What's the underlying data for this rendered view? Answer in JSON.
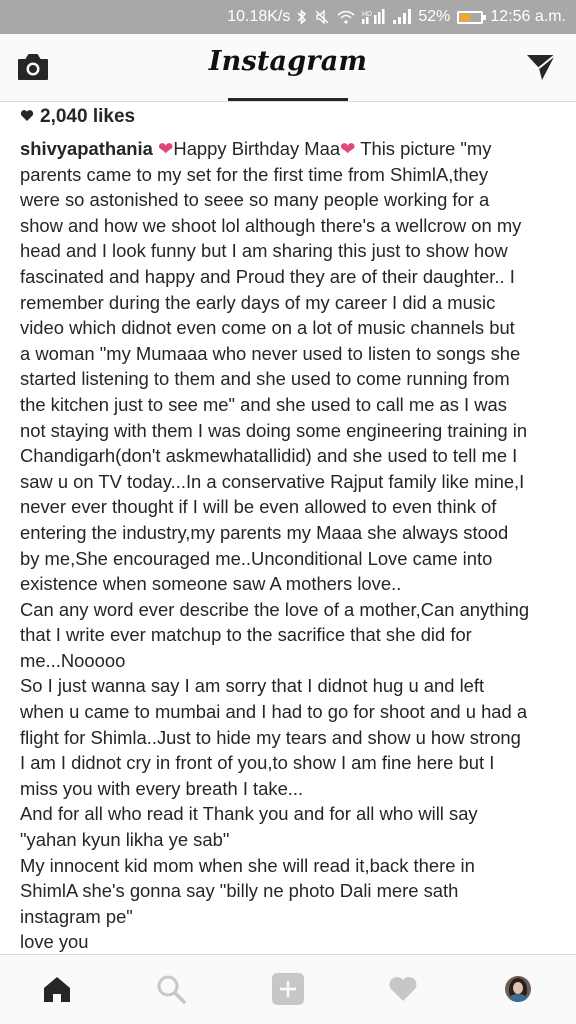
{
  "status_bar": {
    "speed": "10.18K/s",
    "battery_percent": "52%",
    "battery_level": 0.52,
    "time": "12:56 a.m.",
    "icons": [
      "bluetooth-icon",
      "mute-icon",
      "wifi-icon",
      "hd-signal-icon",
      "signal-icon",
      "signal-icon",
      "battery-icon"
    ]
  },
  "header": {
    "logo": "Instagram",
    "left_icon": "camera-icon",
    "right_icon": "direct-send-icon"
  },
  "post": {
    "likes": "2,040 likes",
    "username": "shivyapathania",
    "caption_lines": [
      "Happy Birthday Maa",
      " This picture \"my",
      "parents came to my set for the first time from ShimlA,they",
      "were so astonished to seee so many people working for a",
      "show and how we shoot lol although there's a wellcrow on my",
      "head and I look funny but I am sharing this just to show how",
      "fascinated and happy and Proud they are of their daughter.. I",
      "remember during the early days of my career I did a music",
      "video which didnot even come on a lot of music channels but",
      "a woman \"my Mumaaa who never used to listen to songs she",
      "started listening to them and  she used to come running from",
      "the kitchen just to see me\" and she used to call me as I was",
      "not staying with them I was doing some engineering training in",
      "Chandigarh(don't askmewhatallidid) and she used to tell me I",
      "saw u on TV today...In a conservative Rajput family like mine,I",
      "never ever thought if I will be even allowed to even think of",
      "entering the industry,my parents my Maaa she always stood",
      "by me,She encouraged me..Unconditional Love came into",
      "existence when someone saw A mothers love..",
      "Can any word ever describe the love of a mother,Can anything",
      "that I write ever matchup to the sacrifice that she did for",
      "me...Nooooo",
      "So I just wanna say I am sorry that I didnot hug u and left",
      "when u came to mumbai and I had to go for shoot and u had a",
      "flight for Shimla..Just to hide my tears and show u how strong",
      "I am I didnot cry in front of you,to show I am fine here but I",
      "miss you with every breath I take...",
      "And for all who read it Thank you and for all who will say",
      "\"yahan kyun likha ye sab\"",
      "My innocent kid mom when she will read it,back there in",
      "ShimlA she's gonna say \"billy ne photo Dali mere sath",
      "instagram pe\"",
      "love you"
    ]
  },
  "bottom_nav": {
    "items": [
      "home-icon",
      "search-icon",
      "add-post-icon",
      "activity-heart-icon",
      "profile-avatar"
    ],
    "active": "home-icon"
  },
  "colors": {
    "status_bar": "#a8a8a8",
    "heart_emoji": "#e0457b",
    "battery": "#f5a623",
    "text": "#262626"
  }
}
